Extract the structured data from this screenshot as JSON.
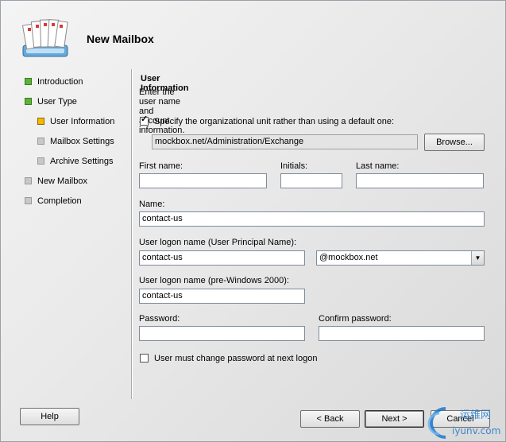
{
  "wizard": {
    "title": "New Mailbox"
  },
  "sidebar": {
    "items": [
      {
        "label": "Introduction",
        "state": "green"
      },
      {
        "label": "User Type",
        "state": "green"
      },
      {
        "label": "User Information",
        "state": "yellow"
      },
      {
        "label": "Mailbox Settings",
        "state": "gray"
      },
      {
        "label": "Archive Settings",
        "state": "gray"
      },
      {
        "label": "New Mailbox",
        "state": "gray"
      },
      {
        "label": "Completion",
        "state": "gray"
      }
    ]
  },
  "main": {
    "section_title": "User Information",
    "section_desc": "Enter the user name and account information.",
    "specify_ou_label": "Specify the organizational unit rather than using a default one:",
    "specify_ou_checked": true,
    "ou_path": "mockbox.net/Administration/Exchange",
    "browse_label": "Browse...",
    "first_name_label": "First name:",
    "first_name_value": "",
    "initials_label": "Initials:",
    "initials_value": "",
    "last_name_label": "Last name:",
    "last_name_value": "",
    "name_label": "Name:",
    "name_value": "contact-us",
    "upn_label": "User logon name (User Principal Name):",
    "upn_value": "contact-us",
    "domain_value": "@mockbox.net",
    "pre2000_label": "User logon name (pre-Windows 2000):",
    "pre2000_value": "contact-us",
    "password_label": "Password:",
    "password_value": "",
    "confirm_password_label": "Confirm password:",
    "confirm_password_value": "",
    "must_change_label": "User must change password at next logon",
    "must_change_checked": false
  },
  "footer": {
    "help_label": "Help",
    "back_label": "< Back",
    "next_label": "Next >",
    "cancel_label": "Cancel"
  },
  "watermark": {
    "text_top": "运维网",
    "text_bottom": "iyunv.com"
  }
}
